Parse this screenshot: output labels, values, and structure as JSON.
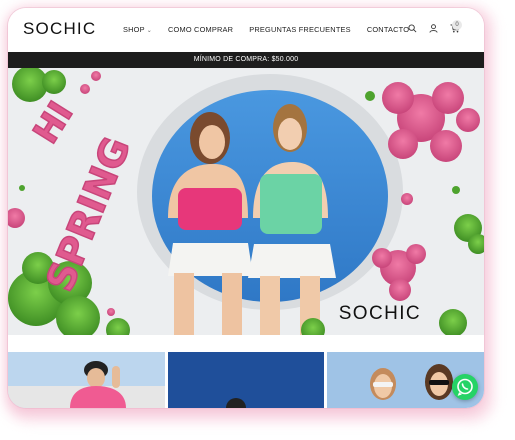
{
  "brand": {
    "logo_text": "SOCHIC"
  },
  "nav": {
    "items": [
      {
        "label": "SHOP",
        "caret": "⌄"
      },
      {
        "label": "COMO COMPRAR"
      },
      {
        "label": "PREGUNTAS FRECUENTES"
      },
      {
        "label": "CONTACTO"
      }
    ]
  },
  "header_icons": [
    "search-icon",
    "user-icon",
    "cart-icon"
  ],
  "cart": {
    "count": "0"
  },
  "announcement": {
    "text": "MÍNIMO DE COMPRA: $50.000"
  },
  "hero": {
    "headline": "HI SPRING",
    "brand_overlay": "SOCHIC",
    "colors": {
      "pink": "#e05a8f",
      "green": "#5aa534",
      "sky": "#3c8bd6",
      "background": "#eef0f2"
    }
  },
  "products": [
    {
      "name": "product-card-1"
    },
    {
      "name": "product-card-2"
    },
    {
      "name": "product-card-3"
    }
  ],
  "whatsapp": {
    "icon": "whatsapp-icon",
    "color": "#25d366"
  }
}
